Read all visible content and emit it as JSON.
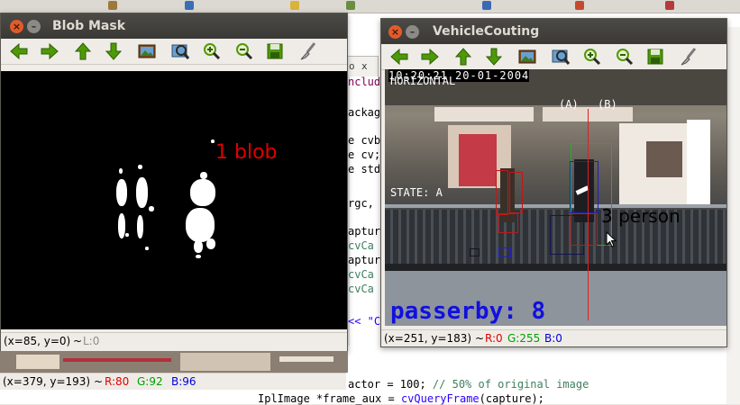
{
  "ide": {
    "tab_close": "x",
    "code_lines": [
      {
        "text": "nclud",
        "cls": "kw"
      },
      {
        "text": "ackag",
        "cls": ""
      },
      {
        "text": "e cvb",
        "cls": ""
      },
      {
        "text": "e cv;",
        "cls": ""
      },
      {
        "text": "e std",
        "cls": ""
      },
      {
        "text": "rgc,",
        "cls": ""
      },
      {
        "text": "aptur",
        "cls": ""
      },
      {
        "text": "cvCa",
        "cls": "green"
      },
      {
        "text": "aptur",
        "cls": ""
      },
      {
        "text": "cvCa",
        "cls": "green"
      },
      {
        "text": "cvCa",
        "cls": "green"
      },
      {
        "text": "<< \"C",
        "cls": "str"
      }
    ],
    "bottom_lines": [
      {
        "text": "actor = 100; // 50% of original image"
      },
      {
        "text": "IplImage *frame_aux = cvQueryFrame(capture);"
      }
    ]
  },
  "blob_window": {
    "title": "Blob Mask",
    "overlay_label": "1 blob",
    "status": {
      "coords": "(x=85, y=0)",
      "sep": "~",
      "extra": "L:0"
    },
    "lower_status": {
      "coords": "(x=379, y=193)",
      "sep": "~",
      "r": "R:80",
      "g": "G:92",
      "b": "B:96"
    }
  },
  "vehicle_window": {
    "title": "VehicleCouting",
    "overlay": {
      "timestamp": "10:20:21 20-01-2004",
      "mode": "HORIZONTAL",
      "label_a": "(A)",
      "label_b": "(B)",
      "state": "STATE: A",
      "person_count": "3 person",
      "passerby": "passerby: 8"
    },
    "status": {
      "coords": "(x=251, y=183)",
      "sep": "~",
      "r": "R:0",
      "g": "G:255",
      "b": "B:0"
    }
  },
  "toolbar_icons": [
    "arrow-left-icon",
    "arrow-right-icon",
    "arrow-up-icon",
    "arrow-down-icon",
    "image-icon",
    "zoom-fit-icon",
    "zoom-in-icon",
    "zoom-out-icon",
    "save-icon",
    "brush-icon"
  ],
  "colors": {
    "accent_red": "#e00000",
    "accent_green": "#00a000",
    "accent_blue": "#0000e0",
    "titlebar": "#3c3b37"
  }
}
